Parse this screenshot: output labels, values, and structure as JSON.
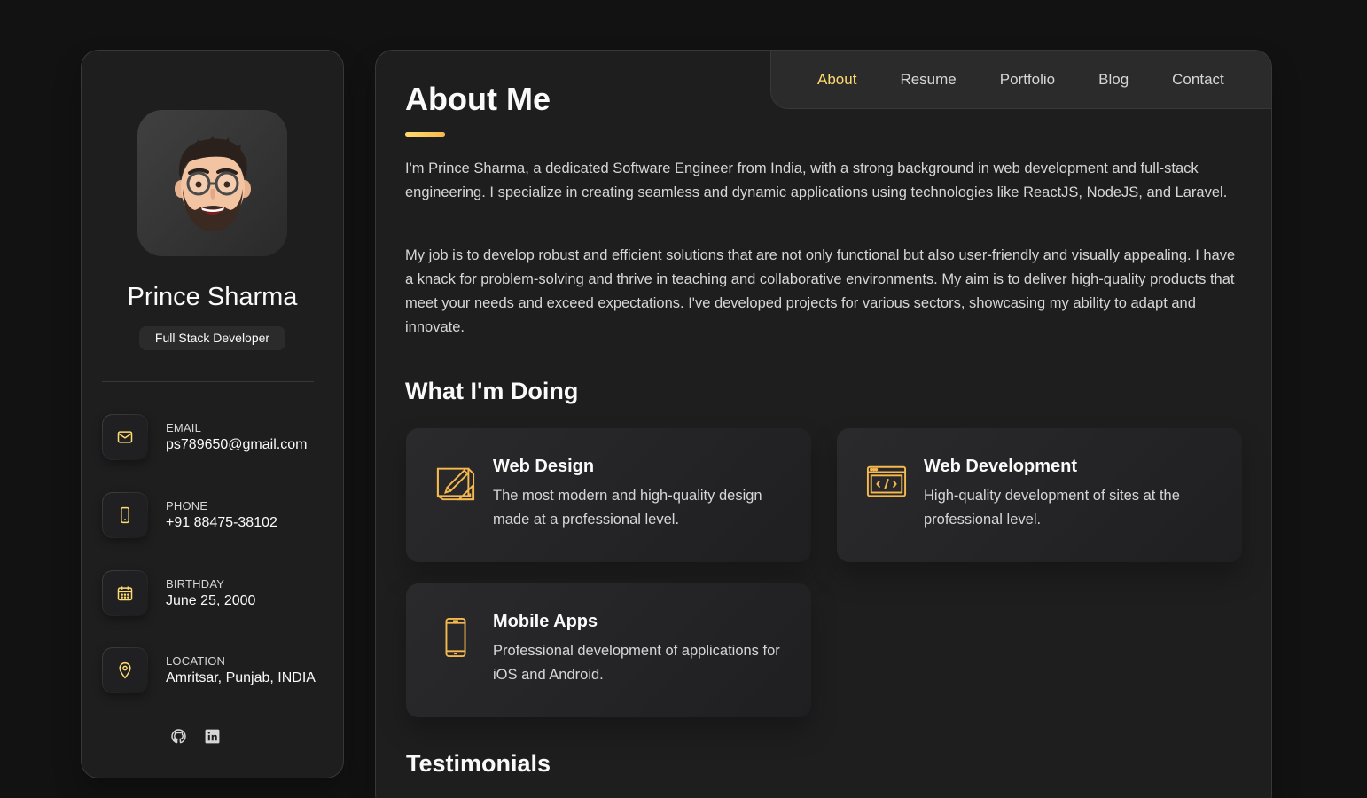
{
  "accent": "#ffdb70",
  "profile": {
    "name": "Prince Sharma",
    "title": "Full Stack Developer"
  },
  "contacts": [
    {
      "label": "EMAIL",
      "value": "ps789650@gmail.com",
      "icon": "mail-icon"
    },
    {
      "label": "PHONE",
      "value": "+91 88475-38102",
      "icon": "phone-icon"
    },
    {
      "label": "BIRTHDAY",
      "value": "June 25, 2000",
      "icon": "calendar-icon"
    },
    {
      "label": "LOCATION",
      "value": "Amritsar, Punjab, INDIA",
      "icon": "location-icon"
    }
  ],
  "socials": [
    "github-icon",
    "linkedin-icon"
  ],
  "nav": {
    "items": [
      "About",
      "Resume",
      "Portfolio",
      "Blog",
      "Contact"
    ],
    "active": "About"
  },
  "about": {
    "title": "About Me",
    "paragraphs": [
      "I'm Prince Sharma, a dedicated Software Engineer from India, with a strong background in web development and full-stack engineering. I specialize in creating seamless and dynamic applications using technologies like ReactJS, NodeJS, and Laravel.",
      "My job is to develop robust and efficient solutions that are not only functional but also user-friendly and visually appealing. I have a knack for problem-solving and thrive in teaching and collaborative environments. My aim is to deliver high-quality products that meet your needs and exceed expectations. I've developed projects for various sectors, showcasing my ability to adapt and innovate."
    ]
  },
  "services": {
    "title": "What I'm Doing",
    "items": [
      {
        "title": "Web Design",
        "text": "The most modern and high-quality design made at a professional level.",
        "icon": "design-icon"
      },
      {
        "title": "Web Development",
        "text": "High-quality development of sites at the professional level.",
        "icon": "code-icon"
      },
      {
        "title": "Mobile Apps",
        "text": "Professional development of applications for iOS and Android.",
        "icon": "mobile-icon"
      }
    ]
  },
  "testimonials": {
    "title": "Testimonials"
  }
}
